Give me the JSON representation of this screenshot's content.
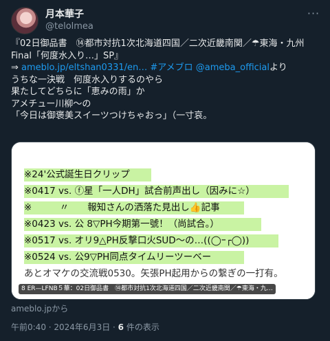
{
  "author": {
    "display_name": "月本華子",
    "handle": "@telolmea"
  },
  "post": {
    "lines": [
      "『02日御品書　⑭都市対抗1次北海道四国／二次近畿南関／☂東海・九州",
      "Final「何度水入り…」SP』",
      "",
      "うちな一決戦　何度水入りするのやら",
      "果たしてどちらに「恵みの雨」か",
      "アメチュー川柳～の",
      "「今日は御褒美スイーツつけちゃおっ」（一寸哀。"
    ],
    "link_line": {
      "arrow": "⇒ ",
      "url": "ameblo.jp/eltshan0331/en…",
      "hashtag": "#アメブロ",
      "mention": "@ameba_official",
      "suffix": "より"
    }
  },
  "card": {
    "highlighted_lines": [
      "※24'公式誕生日クリップ",
      "※0417 vs. ⓕ星「一人DH」試合前声出し（因みに☆）",
      "※　　　〃　　報知さんの洒落た見出し👍記事",
      "※0423 vs. 公 8▽PH今期第一號！（尚試合。）",
      "※0517 vs. オリ9△PH反撃口火SUD～の…((◯ｰ┌◯))",
      "※0524 vs. 公9▽PH同点タイムリーツーベー"
    ],
    "plain_line": "あとオマケの交流戦0530。矢張PH起用からの繋ぎの一打有。",
    "label": "8 ER—LFNB５華：02日御品書　⑭都市対抗1次北海道四国／二次近畿南関／☂東海・九…",
    "domain": "ameblo.jpから"
  },
  "meta": {
    "time_date": "午前0:40 · 2024年6月3日 · ",
    "views_count": "6",
    "views_label": " 件の表示"
  },
  "colors": {
    "background": "#15202b",
    "link": "#1d9bf0",
    "highlight": "#c9f3a3"
  },
  "icons": {
    "more": "more-dots-icon"
  }
}
